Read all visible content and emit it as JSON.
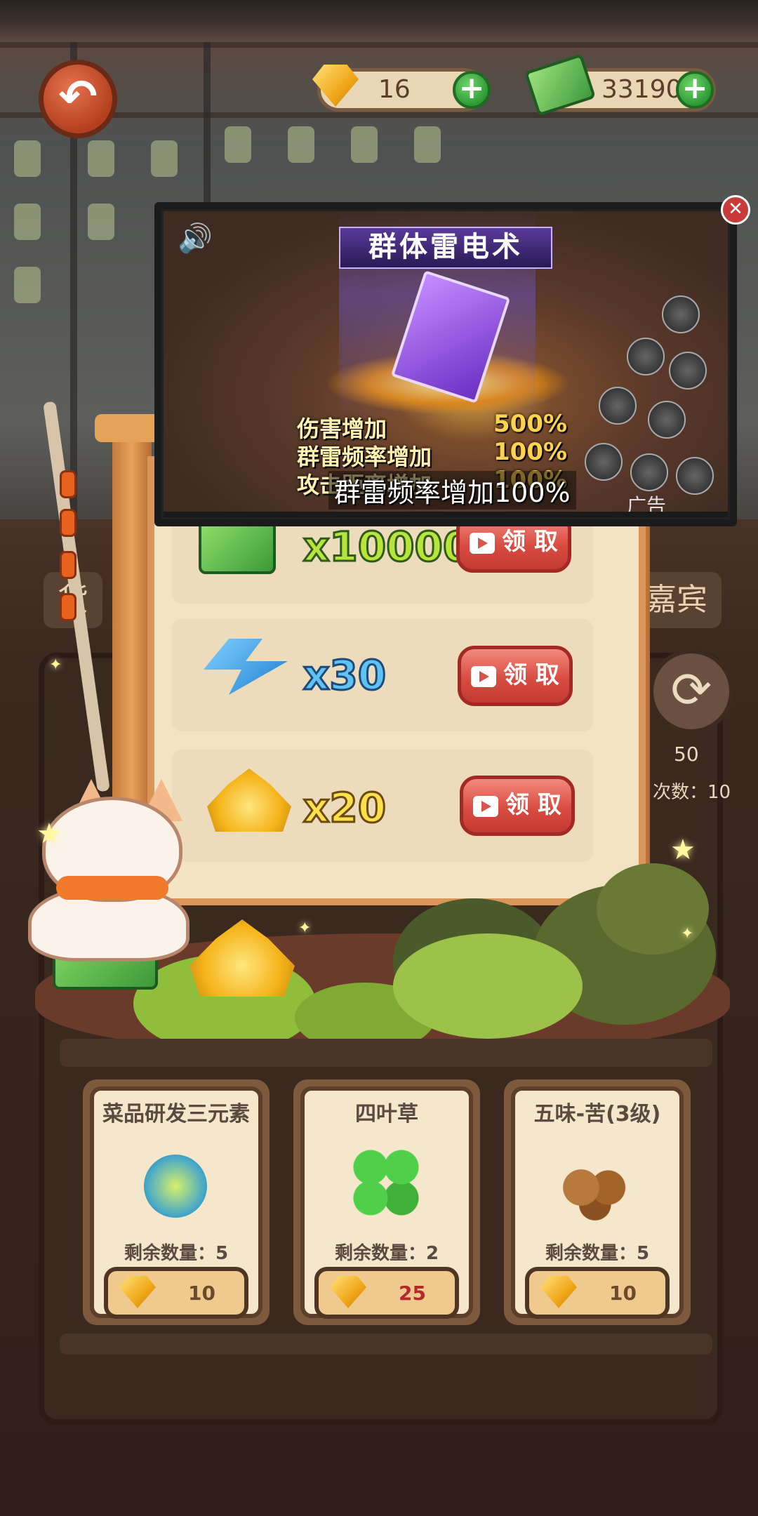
{
  "top_bar": {
    "gems": "16",
    "cash": "331904",
    "back_icon": "back-arrow-icon",
    "plus_icon": "plus-icon"
  },
  "ad": {
    "title": "群体雷电术",
    "stats": [
      {
        "label": "伤害增加",
        "value": "500%"
      },
      {
        "label": "群雷频率增加",
        "value": "100%"
      },
      {
        "label": "攻击距离增加",
        "value": "100%"
      }
    ],
    "caption": "群雷频率增加100%",
    "mark": "广告",
    "close_icon": "close-icon",
    "sound_icon": "speaker-icon"
  },
  "rewards": [
    {
      "qty": "x100000",
      "button": "领 取",
      "icon": "cash-stack-icon"
    },
    {
      "qty": "x30",
      "button": "领 取",
      "icon": "lightning-icon"
    },
    {
      "qty": "x20",
      "button": "领 取",
      "icon": "gold-pile-icon"
    }
  ],
  "side": {
    "left_tab": "货",
    "right_tab": "嘉宾",
    "count": "50",
    "times_label": "次数：10"
  },
  "shop_items": [
    {
      "title": "菜品研发三元素",
      "remaining": "剩余数量：5",
      "price": "10",
      "icon": "bulb-icon"
    },
    {
      "title": "四叶草",
      "remaining": "剩余数量：2",
      "price": "25",
      "icon": "clover-icon"
    },
    {
      "title": "五味-苦(3级)",
      "remaining": "剩余数量：5",
      "price": "10",
      "icon": "coffee-beans-icon"
    }
  ],
  "colors": {
    "claim_button": "#d94c42",
    "plus_green": "#2f9a34",
    "board": "#f2e3c2"
  }
}
